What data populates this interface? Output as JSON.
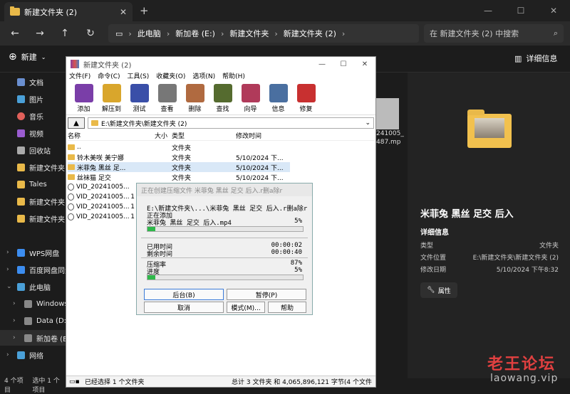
{
  "explorer": {
    "tab_title": "新建文件夹 (2)",
    "new_tab": "+",
    "breadcrumb": [
      "此电脑",
      "新加卷 (E:)",
      "新建文件夹",
      "新建文件夹 (2)"
    ],
    "search_placeholder": "在 新建文件夹 (2) 中搜索",
    "new_button": "新建",
    "details_button": "详细信息",
    "sidebar": [
      {
        "label": "文档",
        "icon": "document-icon",
        "color": "#6a8fd0"
      },
      {
        "label": "图片",
        "icon": "picture-icon",
        "color": "#4aa0d8"
      },
      {
        "label": "音乐",
        "icon": "music-icon",
        "color": "#e0605a"
      },
      {
        "label": "视频",
        "icon": "video-icon",
        "color": "#9a5cd0"
      },
      {
        "label": "回收站",
        "icon": "recycle-bin-icon",
        "color": "#aaaaaa"
      },
      {
        "label": "新建文件夹",
        "icon": "folder-icon",
        "color": "#e9b949"
      },
      {
        "label": "Tales",
        "icon": "folder-icon",
        "color": "#e9b949"
      },
      {
        "label": "新建文件夹",
        "icon": "folder-icon",
        "color": "#e9b949"
      },
      {
        "label": "新建文件夹",
        "icon": "folder-icon",
        "color": "#e9b949"
      },
      {
        "label": "WPS网盘",
        "icon": "cloud-icon",
        "color": "#3c8df0"
      },
      {
        "label": "百度网盘同步",
        "icon": "cloud-icon",
        "color": "#3c8df0"
      },
      {
        "label": "此电脑",
        "icon": "computer-icon",
        "color": "#4aa0d8"
      },
      {
        "label": "Windows-",
        "icon": "drive-icon",
        "color": "#888888"
      },
      {
        "label": "Data (D:)",
        "icon": "drive-icon",
        "color": "#888888"
      },
      {
        "label": "新加卷 (E:)",
        "icon": "drive-icon",
        "color": "#888888"
      },
      {
        "label": "网络",
        "icon": "network-icon",
        "color": "#4aa0d8"
      }
    ],
    "status_count": "4 个项目",
    "status_selected": "选中 1 个项目",
    "bg_file_caption": "241005_ 487.mp"
  },
  "details": {
    "name": "米菲兔 黑丝 足交 后入",
    "section": "详细信息",
    "rows": [
      {
        "key": "类型",
        "value": "文件夹"
      },
      {
        "key": "文件位置",
        "value": "E:\\新建文件夹\\新建文件夹 (2)"
      },
      {
        "key": "修改日期",
        "value": "5/10/2024 下午8:32"
      }
    ],
    "properties_button": "属性"
  },
  "watermark": {
    "text": "老王论坛",
    "url": "laowang.vip"
  },
  "rar": {
    "title": "新建文件夹 (2)",
    "menu": [
      "文件(F)",
      "命令(C)",
      "工具(S)",
      "收藏夹(O)",
      "选项(N)",
      "帮助(H)"
    ],
    "tools": [
      {
        "label": "添加",
        "icon": "add-archive-icon",
        "color": "#7a3ea8"
      },
      {
        "label": "解压到",
        "icon": "extract-icon",
        "color": "#d9a62c"
      },
      {
        "label": "测试",
        "icon": "test-icon",
        "color": "#3a4fa8"
      },
      {
        "label": "查看",
        "icon": "view-icon",
        "color": "#777777"
      },
      {
        "label": "删除",
        "icon": "delete-icon",
        "color": "#b06a40"
      },
      {
        "label": "查找",
        "icon": "find-icon",
        "color": "#556b2f"
      },
      {
        "label": "向导",
        "icon": "wizard-icon",
        "color": "#b03a5a"
      },
      {
        "label": "信息",
        "icon": "info-icon",
        "color": "#4a6fa0"
      },
      {
        "label": "修复",
        "icon": "repair-icon",
        "color": "#c83030"
      }
    ],
    "path": "E:\\新建文件夹\\新建文件夹 (2)",
    "columns": [
      "名称",
      "大小",
      "类型",
      "修改时间"
    ],
    "files": [
      {
        "name": "..",
        "size": "",
        "type": "文件夹",
        "mtime": "",
        "kind": "folder"
      },
      {
        "name": "铃木美咲 美宁娜",
        "size": "",
        "type": "文件夹",
        "mtime": "5/10/2024 下...",
        "kind": "folder"
      },
      {
        "name": "米菲兔 黑丝 足...",
        "size": "",
        "type": "文件夹",
        "mtime": "5/10/2024 下...",
        "kind": "folder"
      },
      {
        "name": "丝袜猫 足交",
        "size": "",
        "type": "文件夹",
        "mtime": "5/10/2024 下...",
        "kind": "folder"
      },
      {
        "name": "VID_20241005...",
        "size": "",
        "type": "",
        "mtime": "",
        "kind": "video"
      },
      {
        "name": "VID_20241005...",
        "size": "1",
        "type": "",
        "mtime": "",
        "kind": "video"
      },
      {
        "name": "VID_20241005...",
        "size": "1",
        "type": "",
        "mtime": "",
        "kind": "video"
      },
      {
        "name": "VID_20241005...",
        "size": "1",
        "type": "",
        "mtime": "",
        "kind": "video"
      }
    ],
    "status_left": "已经选择 1 个文件夹",
    "status_right": "总计 3 文件夹 和 4,065,896,121 字节(4 个文件"
  },
  "progress": {
    "title": "正在创建压缩文件 米菲兔 黑丝 足交 后入.r删a除r",
    "archive_path": "E:\\新建文件夹\\...\\米菲兔 黑丝 足交 后入.r删a除r",
    "action": "正在添加",
    "current_file": "米菲兔 黑丝 足交 后入.mp4",
    "file_percent_text": "5%",
    "file_progress": 0.05,
    "elapsed_label": "已用时间",
    "elapsed": "00:00:02",
    "remaining_label": "剩余时间",
    "remaining": "00:00:40",
    "ratio_label": "压缩率",
    "ratio": "87%",
    "progress_label": "进度",
    "total_percent_text": "5%",
    "total_progress": 0.05,
    "buttons": [
      "后台(B)",
      "暂停(P)",
      "取消",
      "模式(M)...",
      "帮助"
    ]
  }
}
